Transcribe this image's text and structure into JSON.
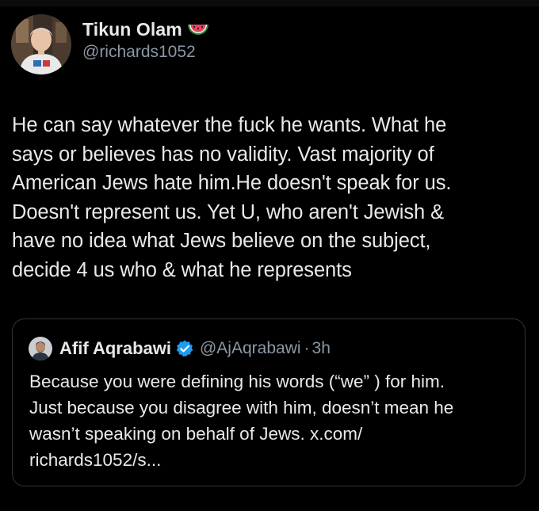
{
  "tweet": {
    "author": {
      "display_name": "Tikun Olam",
      "emoji": "watermelon-emoji",
      "handle": "@richards1052",
      "avatar": "avatar-photo"
    },
    "text_lines": [
      "He can say whatever the fuck he wants. What he",
      "says or believes has no validity.  Vast majority of",
      "American Jews hate him.He doesn't speak for us.",
      "Doesn't represent us.  Yet U, who aren't Jewish &",
      "have no idea what Jews believe on the subject,",
      "decide 4 us who & what he represents"
    ]
  },
  "quoted_tweet": {
    "author": {
      "display_name": "Afif Aqrabawi",
      "verified_icon": "verified-badge-icon",
      "handle": "@AjAqrabawi",
      "separator": "·",
      "time": "3h"
    },
    "text_lines": [
      "Because you were defining his words (“we” ) for him.",
      "Just because you disagree with him, doesn’t mean he",
      "wasn’t speaking on behalf of Jews. x.com/",
      "richards1052/s..."
    ]
  },
  "colors": {
    "background": "#000000",
    "primary_text": "#e7e9ea",
    "secondary_text": "#8b98a5",
    "border": "#2f3336",
    "verified_blue": "#1d9bf0"
  }
}
